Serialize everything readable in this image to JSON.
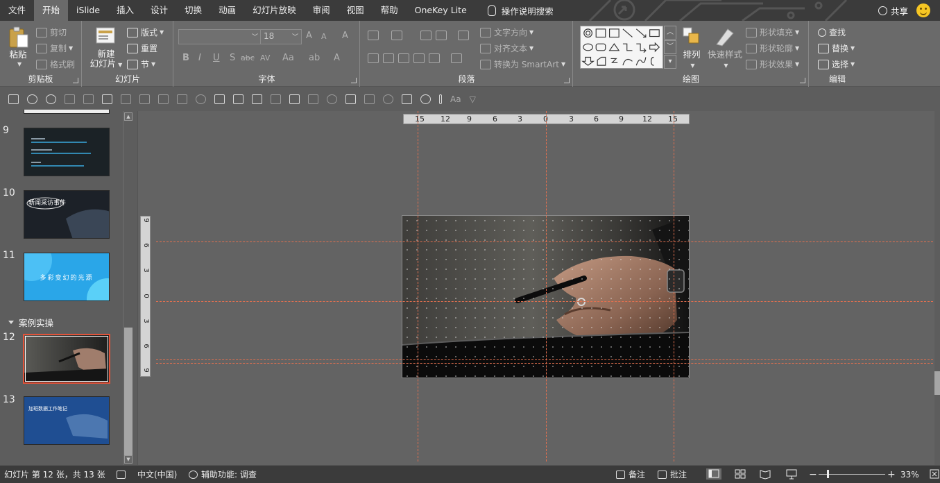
{
  "menu": {
    "tabs": [
      "文件",
      "开始",
      "iSlide",
      "插入",
      "设计",
      "切换",
      "动画",
      "幻灯片放映",
      "审阅",
      "视图",
      "帮助",
      "OneKey Lite"
    ],
    "active_index": 1,
    "tell_me": "操作说明搜索",
    "share": "共享"
  },
  "ribbon": {
    "clipboard": {
      "label": "剪贴板",
      "paste": "粘贴",
      "cut": "剪切",
      "copy": "复制",
      "format_painter": "格式刷"
    },
    "slides": {
      "label": "幻灯片",
      "new_slide_line1": "新建",
      "new_slide_line2": "幻灯片",
      "layout": "版式",
      "reset": "重置",
      "section": "节"
    },
    "font": {
      "label": "字体",
      "font_name": "",
      "font_size": "18",
      "bold": "B",
      "italic": "I",
      "underline": "U",
      "shadow": "S",
      "strike": "abc",
      "spacing": "AV",
      "case": "Aa",
      "grow": "A",
      "shrink": "A",
      "clear": "A",
      "color": "A"
    },
    "paragraph": {
      "label": "段落",
      "text_direction": "文字方向",
      "align_text": "对齐文本",
      "smartart": "转换为 SmartArt"
    },
    "drawing": {
      "label": "绘图",
      "arrange": "排列",
      "quick_styles": "快速样式",
      "shape_fill": "形状填充",
      "shape_outline": "形状轮廓",
      "shape_effects": "形状效果"
    },
    "editing": {
      "label": "编辑",
      "find": "查找",
      "replace": "替换",
      "select": "选择"
    }
  },
  "qat": {
    "font_case": "Aa"
  },
  "thumbnails": {
    "section_name": "案例实操",
    "slides": [
      {
        "number": "9",
        "title": "",
        "selected": false
      },
      {
        "number": "10",
        "title": "新闻采访事件",
        "selected": false
      },
      {
        "number": "11",
        "title": "多彩变幻的光源",
        "selected": false
      },
      {
        "number": "12",
        "title": "",
        "selected": true
      },
      {
        "number": "13",
        "title": "加班数据工作笔记",
        "selected": false
      }
    ]
  },
  "rulers": {
    "horizontal": [
      "15",
      "12",
      "9",
      "6",
      "3",
      "0",
      "3",
      "6",
      "9",
      "12",
      "15"
    ],
    "vertical": [
      "9",
      "6",
      "3",
      "0",
      "3",
      "6",
      "9"
    ]
  },
  "status": {
    "slide_info": "幻灯片 第 12 张，共 13 张",
    "language": "中文(中国)",
    "accessibility": "辅助功能: 调查",
    "notes": "备注",
    "comments": "批注",
    "zoom": "33%",
    "zoom_level": 0.33
  },
  "colors": {
    "accent_selected": "#e2533a",
    "guide": "#e4704f",
    "menubar": "#3b3b3b",
    "ribbon": "#6a6a6a"
  }
}
